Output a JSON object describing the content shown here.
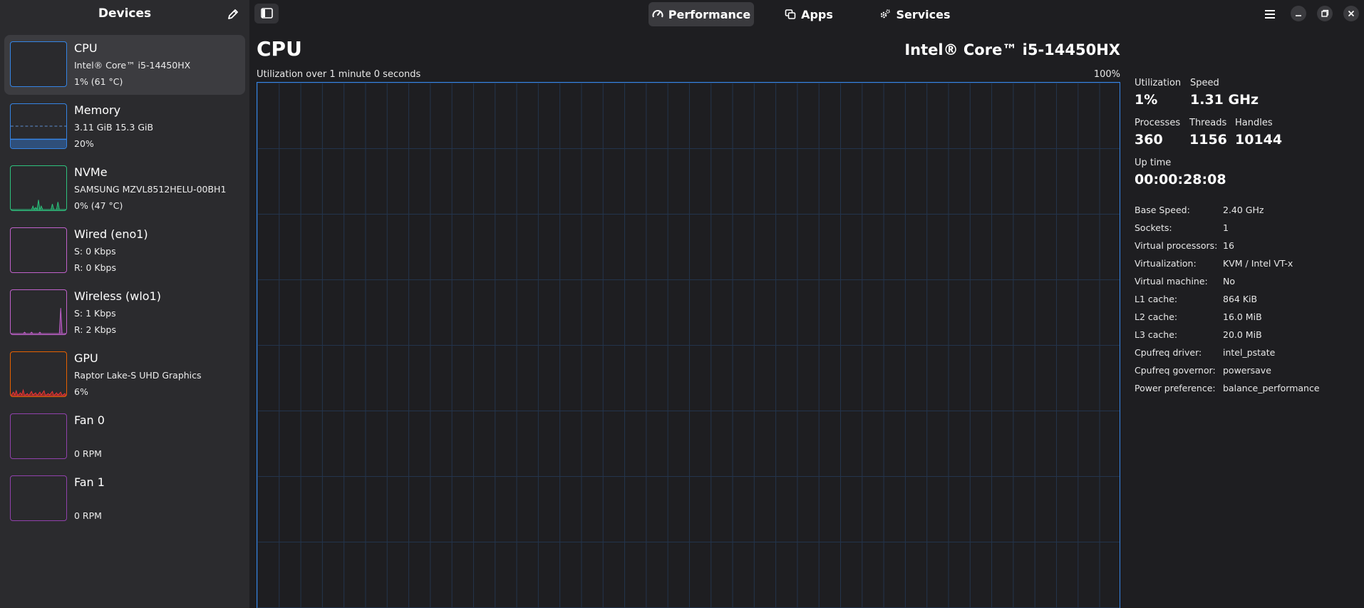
{
  "sidebar": {
    "title": "Devices",
    "devices": [
      {
        "name": "CPU",
        "sub": "Intel® Core™ i5-14450HX",
        "value": "1% (61 °C)",
        "color": "#3584e4"
      },
      {
        "name": "Memory",
        "sub": "3.11 GiB 15.3 GiB",
        "value": "20%",
        "color": "#3584e4"
      },
      {
        "name": "NVMe",
        "sub": "SAMSUNG MZVL8512HELU-00BH1",
        "value": "0% (47 °C)",
        "color": "#2ec27e"
      },
      {
        "name": "Wired (eno1)",
        "sub": "S: 0 Kbps",
        "value": "R: 0 Kbps",
        "color": "#c061cb"
      },
      {
        "name": "Wireless (wlo1)",
        "sub": "S: 1 Kbps",
        "value": "R: 2 Kbps",
        "color": "#c061cb"
      },
      {
        "name": "GPU",
        "sub": "Raptor Lake-S UHD Graphics",
        "value": "6%",
        "color": "#e66100"
      },
      {
        "name": "Fan 0",
        "sub": "",
        "value": "0 RPM",
        "color": "#9141ac"
      },
      {
        "name": "Fan 1",
        "sub": "",
        "value": "0 RPM",
        "color": "#9141ac"
      }
    ]
  },
  "header": {
    "tabs": [
      {
        "label": "Performance",
        "icon": "gauge-icon",
        "active": true
      },
      {
        "label": "Apps",
        "icon": "windows-icon"
      },
      {
        "label": "Services",
        "icon": "gears-icon"
      }
    ]
  },
  "main": {
    "title": "CPU",
    "model": "Intel® Core™ i5-14450HX",
    "graph_caption": "Utilization over 1 minute 0 seconds",
    "graph_max": "100%"
  },
  "stats": {
    "utilization_label": "Utilization",
    "utilization": "1%",
    "speed_label": "Speed",
    "speed": "1.31 GHz",
    "processes_label": "Processes",
    "processes": "360",
    "threads_label": "Threads",
    "threads": "1156",
    "handles_label": "Handles",
    "handles": "10144",
    "uptime_label": "Up time",
    "uptime": "00:00:28:08"
  },
  "properties": [
    {
      "key": "Base Speed:",
      "value": "2.40 GHz"
    },
    {
      "key": "Sockets:",
      "value": "1"
    },
    {
      "key": "Virtual processors:",
      "value": "16"
    },
    {
      "key": "Virtualization:",
      "value": "KVM / Intel VT-x"
    },
    {
      "key": "Virtual machine:",
      "value": "No"
    },
    {
      "key": "L1 cache:",
      "value": "864 KiB"
    },
    {
      "key": "L2 cache:",
      "value": "16.0 MiB"
    },
    {
      "key": "L3 cache:",
      "value": "20.0 MiB"
    },
    {
      "key": "Cpufreq driver:",
      "value": "intel_pstate"
    },
    {
      "key": "Cpufreq governor:",
      "value": "powersave"
    },
    {
      "key": "Power preference:",
      "value": "balance_performance"
    }
  ]
}
